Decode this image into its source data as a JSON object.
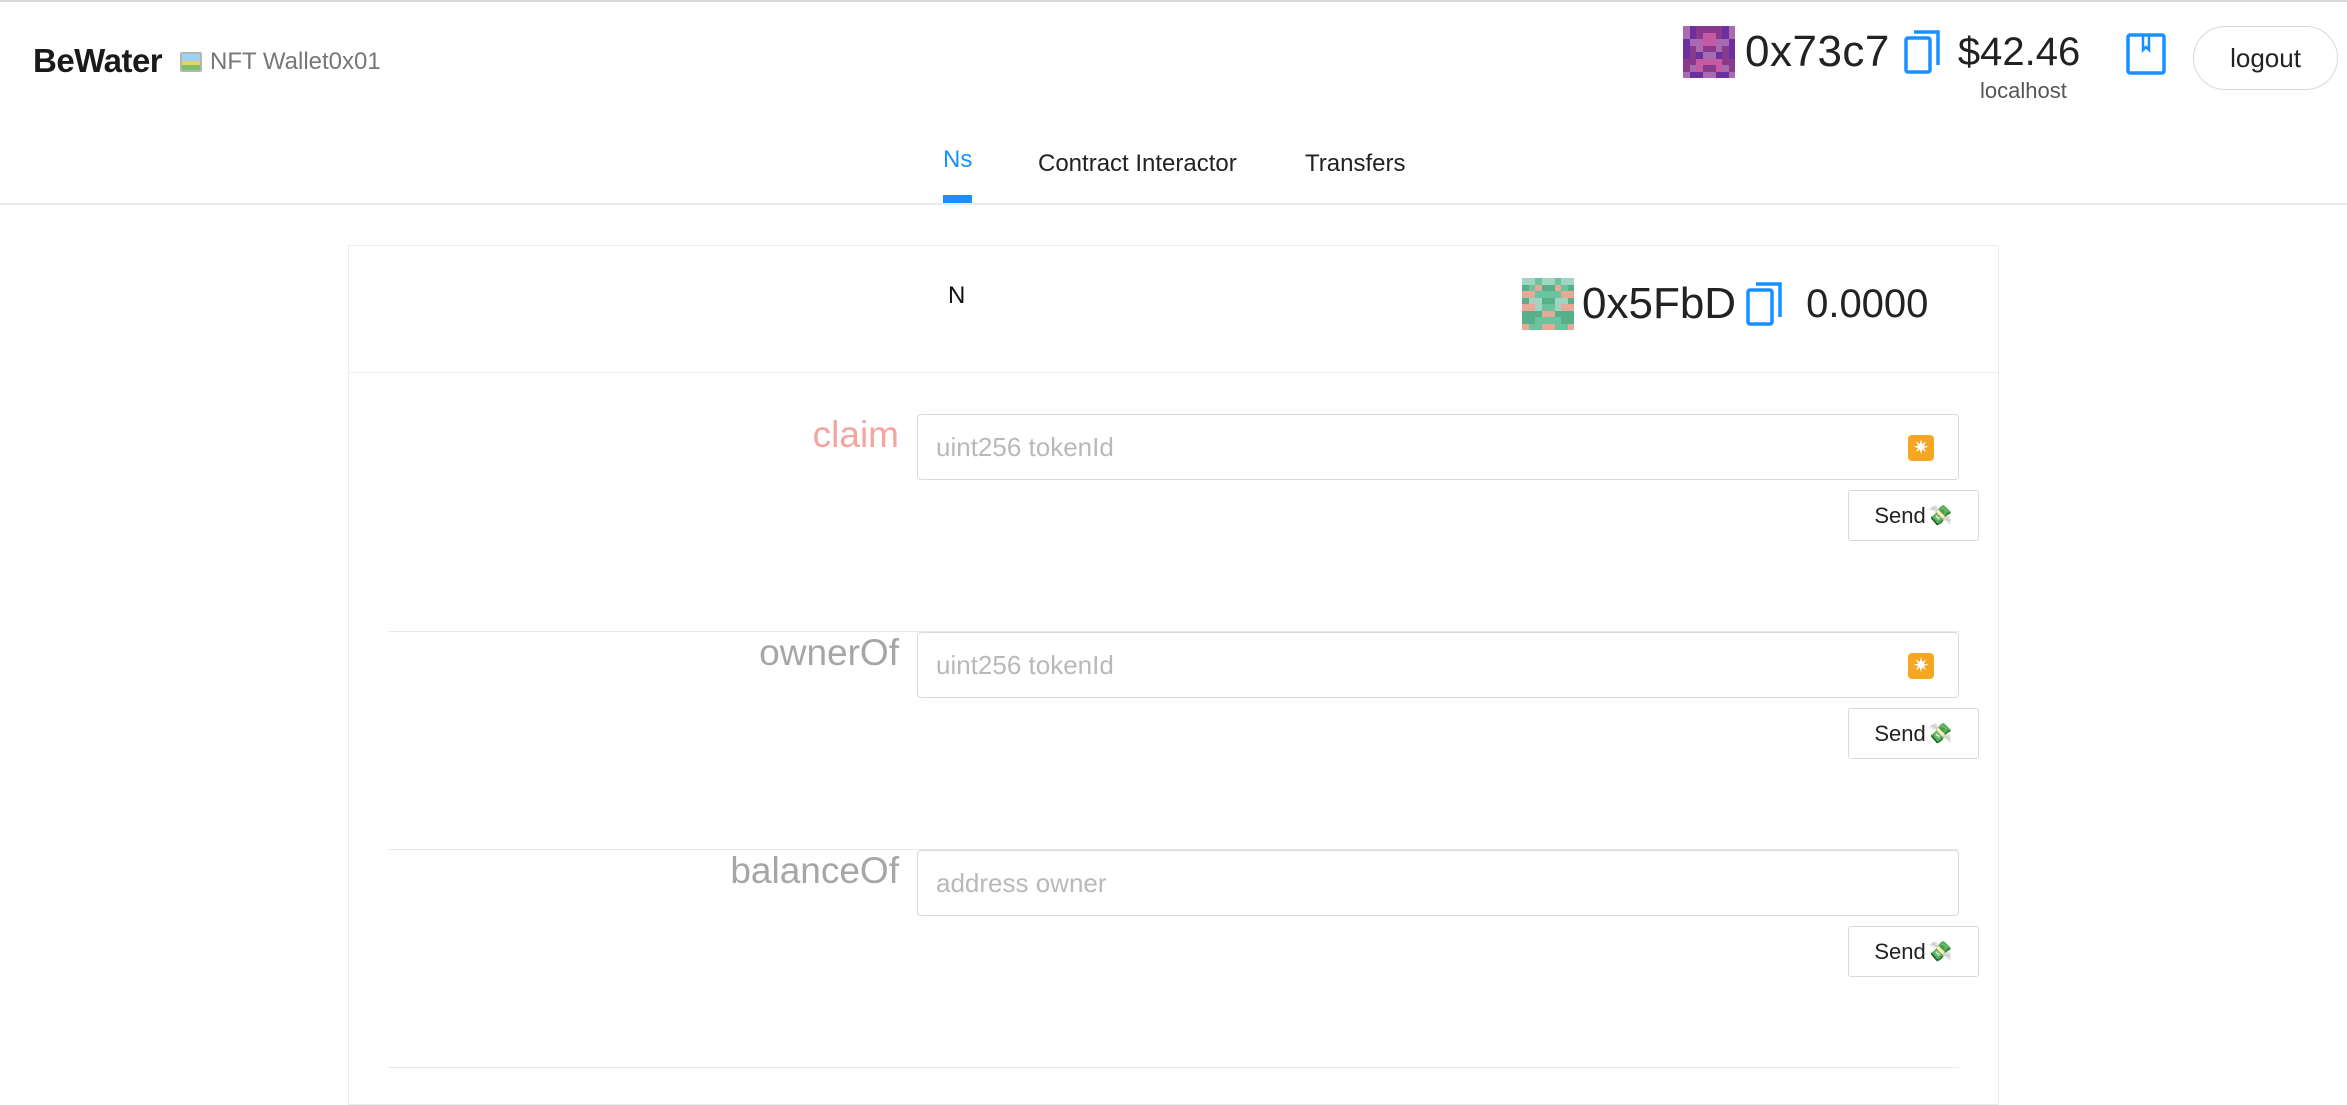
{
  "header": {
    "brand": "BeWater",
    "subtitle": "NFT Wallet0x01",
    "account_address": "0x73c7",
    "balance": "$42.46",
    "network": "localhost",
    "logout_label": "logout"
  },
  "tabs": [
    {
      "label": "Ns",
      "active": true
    },
    {
      "label": "Contract Interactor",
      "active": false
    },
    {
      "label": "Transfers",
      "active": false
    }
  ],
  "contract": {
    "title": "N",
    "address": "0x5FbD",
    "balance": "0.0000"
  },
  "functions": [
    {
      "name": "claim",
      "placeholder": "uint256 tokenId",
      "has_star": true,
      "send_label": "Send"
    },
    {
      "name": "ownerOf",
      "placeholder": "uint256 tokenId",
      "has_star": true,
      "send_label": "Send"
    },
    {
      "name": "balanceOf",
      "placeholder": "address owner",
      "has_star": false,
      "send_label": "Send"
    }
  ],
  "icons": {
    "subtitle_icon": "picture-frame-icon",
    "copy": "copy-icon",
    "address_book": "address-book-icon",
    "star": "star-icon",
    "money": "money-wings-icon"
  },
  "colors": {
    "accent": "#1890ff",
    "claim_label": "#f4a5a0",
    "label_gray": "#a6a6a6",
    "star_orange": "#f6a623"
  }
}
